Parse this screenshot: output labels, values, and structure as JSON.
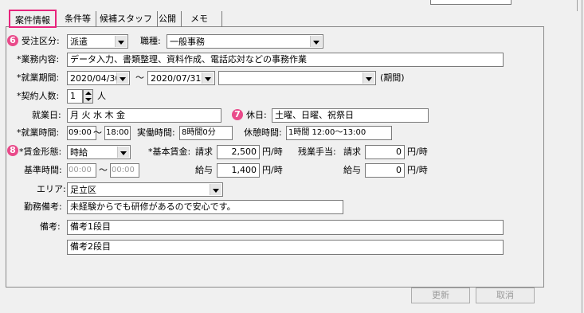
{
  "tabs": [
    "案件情報",
    "条件等",
    "候補スタッフ",
    "公開",
    "メモ"
  ],
  "badges": {
    "six": "6",
    "seven": "7",
    "eight": "8"
  },
  "labels": {
    "juchu_kubun": "受注区分:",
    "shokushu": "職種:",
    "gyomu_naiyo": "*業務内容:",
    "shugyo_kikan": "*就業期間:",
    "kikan_tilde": "～",
    "kikan_suffix": "(期間)",
    "keiyaku_ninzu": "*契約人数:",
    "nin": "人",
    "shugyo_bi": "就業日:",
    "kyujitsu": "休日:",
    "shugyo_jikan": "*就業時間:",
    "jikan_tilde": "～",
    "jitsudo_jikan": "実働時間:",
    "kyukei_jikan": "休憩時間:",
    "chingin_keitai": "*賃金形態:",
    "kihon_chingin": "*基本賃金:",
    "seikyu1": "請求",
    "en_ji1": "円/時",
    "zangyo_teate": "残業手当:",
    "seikyu2": "請求",
    "en_ji2": "円/時",
    "kijun_jikan": "基準時間:",
    "kijun_tilde": "～",
    "kyuyo1": "給与",
    "en_ji3": "円/時",
    "kyuyo2": "給与",
    "en_ji4": "円/時",
    "area": "エリア:",
    "kinmu_biko": "勤務備考:",
    "biko": "備考:"
  },
  "fields": {
    "juchu_kubun": "派遣",
    "shokushu": "一般事務",
    "gyomu_naiyo": "データ入力、書類整理、資料作成、電話応対などの事務作業",
    "kikan_start": "2020/04/30",
    "kikan_end": "2020/07/31",
    "kikan_type": "",
    "ninzu": "1",
    "shugyo_bi": "月 火 水 木 金",
    "kyujitsu": "土曜、日曜、祝祭日",
    "jikan_start": "09:00",
    "jikan_end": "18:00",
    "jitsudo": "8時間0分",
    "kyukei": "1時間 12:00～13:00",
    "chingin_keitai": "時給",
    "kihon_seikyu": "2,500",
    "zangyo_seikyu": "0",
    "kijun_start": "00:00",
    "kijun_end": "00:00",
    "kihon_kyuyo": "1,400",
    "zangyo_kyuyo": "0",
    "area": "足立区",
    "kinmu_biko": "未経験からでも研修があるので安心です。",
    "biko1": "備考1段目",
    "biko2": "備考2段目"
  },
  "buttons": {
    "koshin": "更新",
    "torikeshi": "取消"
  }
}
